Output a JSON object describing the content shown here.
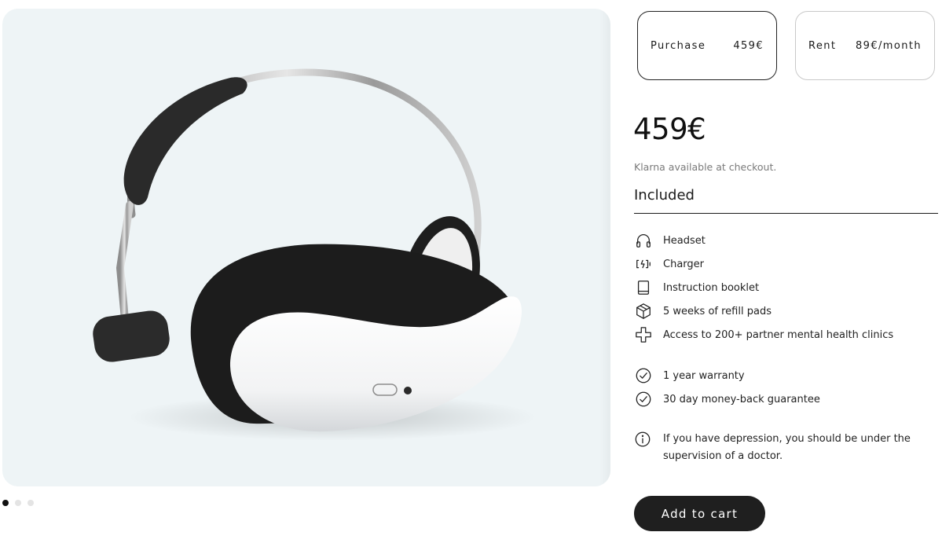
{
  "options": [
    {
      "label": "Purchase",
      "price": "459€"
    },
    {
      "label": "Rent",
      "price": "89€/month"
    }
  ],
  "price": "459€",
  "klarna_note": "Klarna available at checkout.",
  "included_title": "Included",
  "included_items": [
    {
      "icon": "headset-icon",
      "label": "Headset"
    },
    {
      "icon": "battery-charging-icon",
      "label": "Charger"
    },
    {
      "icon": "book-icon",
      "label": "Instruction booklet"
    },
    {
      "icon": "box-icon",
      "label": "5 weeks of refill pads"
    },
    {
      "icon": "medical-cross-icon",
      "label": "Access to 200+ partner mental health clinics"
    }
  ],
  "guarantees": [
    {
      "icon": "check-circle-icon",
      "label": "1 year warranty"
    },
    {
      "icon": "check-circle-icon",
      "label": "30 day money-back guarantee"
    }
  ],
  "disclaimer": "If you have depression, you should be under the supervision of a doctor.",
  "add_to_cart_label": "Add to cart",
  "gallery": {
    "image_count": 3,
    "active_index": 0
  }
}
